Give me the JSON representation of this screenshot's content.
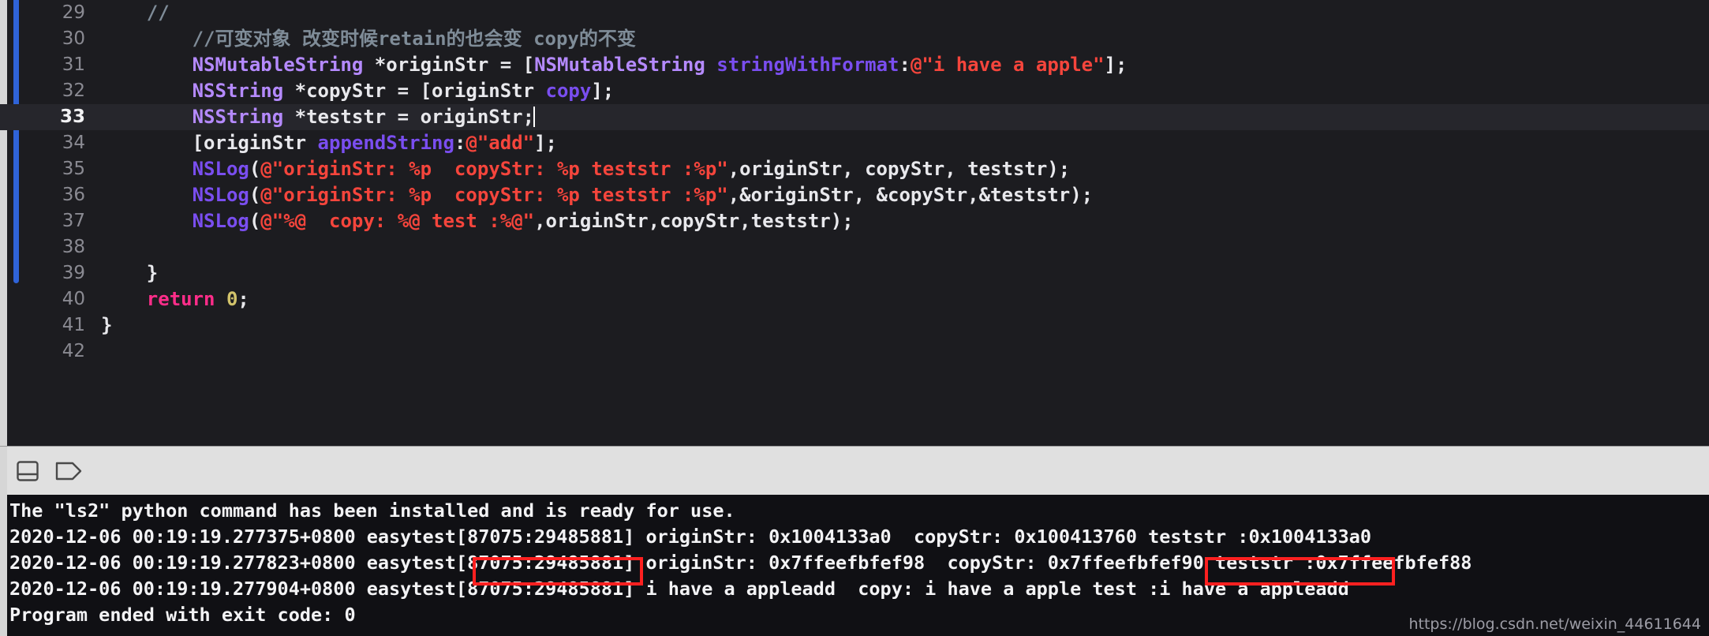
{
  "editor": {
    "current_line": 33,
    "lines": [
      {
        "num": "29",
        "tokens": [
          {
            "t": "    ",
            "c": "plain"
          },
          {
            "t": "//",
            "c": "comment"
          }
        ]
      },
      {
        "num": "30",
        "tokens": [
          {
            "t": "        ",
            "c": "plain"
          },
          {
            "t": "//可变对象 改变时候retain的也会变 copy的不变",
            "c": "comment"
          }
        ]
      },
      {
        "num": "31",
        "tokens": [
          {
            "t": "        ",
            "c": "plain"
          },
          {
            "t": "NSMutableString",
            "c": "cls"
          },
          {
            "t": " *originStr = [",
            "c": "plain"
          },
          {
            "t": "NSMutableString",
            "c": "cls"
          },
          {
            "t": " ",
            "c": "plain"
          },
          {
            "t": "stringWithFormat",
            "c": "meth"
          },
          {
            "t": ":",
            "c": "plain"
          },
          {
            "t": "@\"i have a apple\"",
            "c": "str"
          },
          {
            "t": "];",
            "c": "plain"
          }
        ]
      },
      {
        "num": "32",
        "tokens": [
          {
            "t": "        ",
            "c": "plain"
          },
          {
            "t": "NSString",
            "c": "cls"
          },
          {
            "t": " *copyStr = [originStr ",
            "c": "plain"
          },
          {
            "t": "copy",
            "c": "meth"
          },
          {
            "t": "];",
            "c": "plain"
          }
        ]
      },
      {
        "num": "33",
        "tokens": [
          {
            "t": "        ",
            "c": "plain"
          },
          {
            "t": "NSString",
            "c": "cls"
          },
          {
            "t": " *teststr = originStr;",
            "c": "plain"
          }
        ],
        "caret": true
      },
      {
        "num": "34",
        "tokens": [
          {
            "t": "        [originStr ",
            "c": "plain"
          },
          {
            "t": "appendString",
            "c": "meth"
          },
          {
            "t": ":",
            "c": "plain"
          },
          {
            "t": "@\"add\"",
            "c": "str"
          },
          {
            "t": "];",
            "c": "plain"
          }
        ]
      },
      {
        "num": "35",
        "tokens": [
          {
            "t": "        ",
            "c": "plain"
          },
          {
            "t": "NSLog",
            "c": "meth"
          },
          {
            "t": "(",
            "c": "plain"
          },
          {
            "t": "@\"originStr: %p  copyStr: %p teststr :%p\"",
            "c": "str"
          },
          {
            "t": ",originStr, copyStr, teststr);",
            "c": "plain"
          }
        ]
      },
      {
        "num": "36",
        "tokens": [
          {
            "t": "        ",
            "c": "plain"
          },
          {
            "t": "NSLog",
            "c": "meth"
          },
          {
            "t": "(",
            "c": "plain"
          },
          {
            "t": "@\"originStr: %p  copyStr: %p teststr :%p\"",
            "c": "str"
          },
          {
            "t": ",&originStr, &copyStr,&teststr);",
            "c": "plain"
          }
        ]
      },
      {
        "num": "37",
        "tokens": [
          {
            "t": "        ",
            "c": "plain"
          },
          {
            "t": "NSLog",
            "c": "meth"
          },
          {
            "t": "(",
            "c": "plain"
          },
          {
            "t": "@\"%@  copy: %@ test :%@\"",
            "c": "str"
          },
          {
            "t": ",originStr,copyStr,teststr);",
            "c": "plain"
          }
        ]
      },
      {
        "num": "38",
        "tokens": [
          {
            "t": "",
            "c": "plain"
          }
        ]
      },
      {
        "num": "39",
        "tokens": [
          {
            "t": "    }",
            "c": "plain"
          }
        ]
      },
      {
        "num": "40",
        "tokens": [
          {
            "t": "    ",
            "c": "plain"
          },
          {
            "t": "return",
            "c": "kw"
          },
          {
            "t": " ",
            "c": "plain"
          },
          {
            "t": "0",
            "c": "num"
          },
          {
            "t": ";",
            "c": "plain"
          }
        ]
      },
      {
        "num": "41",
        "tokens": [
          {
            "t": "}",
            "c": "plain"
          }
        ]
      },
      {
        "num": "42",
        "tokens": [
          {
            "t": "",
            "c": "plain"
          }
        ]
      }
    ]
  },
  "toolbar": {
    "split_panel_icon_label": "split-panel-icon",
    "tag_icon_label": "tag-icon"
  },
  "console": {
    "lines": [
      "The \"ls2\" python command has been installed and is ready for use.",
      "2020-12-06 00:19:19.277375+0800 easytest[87075:29485881] originStr: 0x1004133a0  copyStr: 0x100413760 teststr :0x1004133a0",
      "2020-12-06 00:19:19.277823+0800 easytest[87075:29485881] originStr: 0x7ffeefbfef98  copyStr: 0x7ffeefbfef90 teststr :0x7ffeefbfef88",
      "2020-12-06 00:19:19.277904+0800 easytest[87075:29485881] i have a appleadd  copy: i have a apple test :i have a appleadd",
      "Program ended with exit code: 0"
    ],
    "annotations": [
      {
        "name": "highlight-originstr-value",
        "text": "i have a appleadd"
      },
      {
        "name": "highlight-teststr-value",
        "text": ":i have a appleadd"
      }
    ]
  },
  "watermark": {
    "url": "https://blog.csdn.net/weixin_44611644"
  },
  "colors": {
    "editor_bg": "#1c1c20",
    "current_line_bg": "#26262c",
    "console_bg": "#101014",
    "toolbar_bg": "#e0e0e0",
    "block_indicator": "#2f63d8",
    "annotation_red": "#ff2020",
    "string_red": "#f5453c",
    "class_purple": "#b58aff",
    "method_purple": "#7a4ef0",
    "keyword_pink": "#ff2d8a",
    "number_yellow": "#d2c36b",
    "comment_gray": "#7f8c98"
  }
}
